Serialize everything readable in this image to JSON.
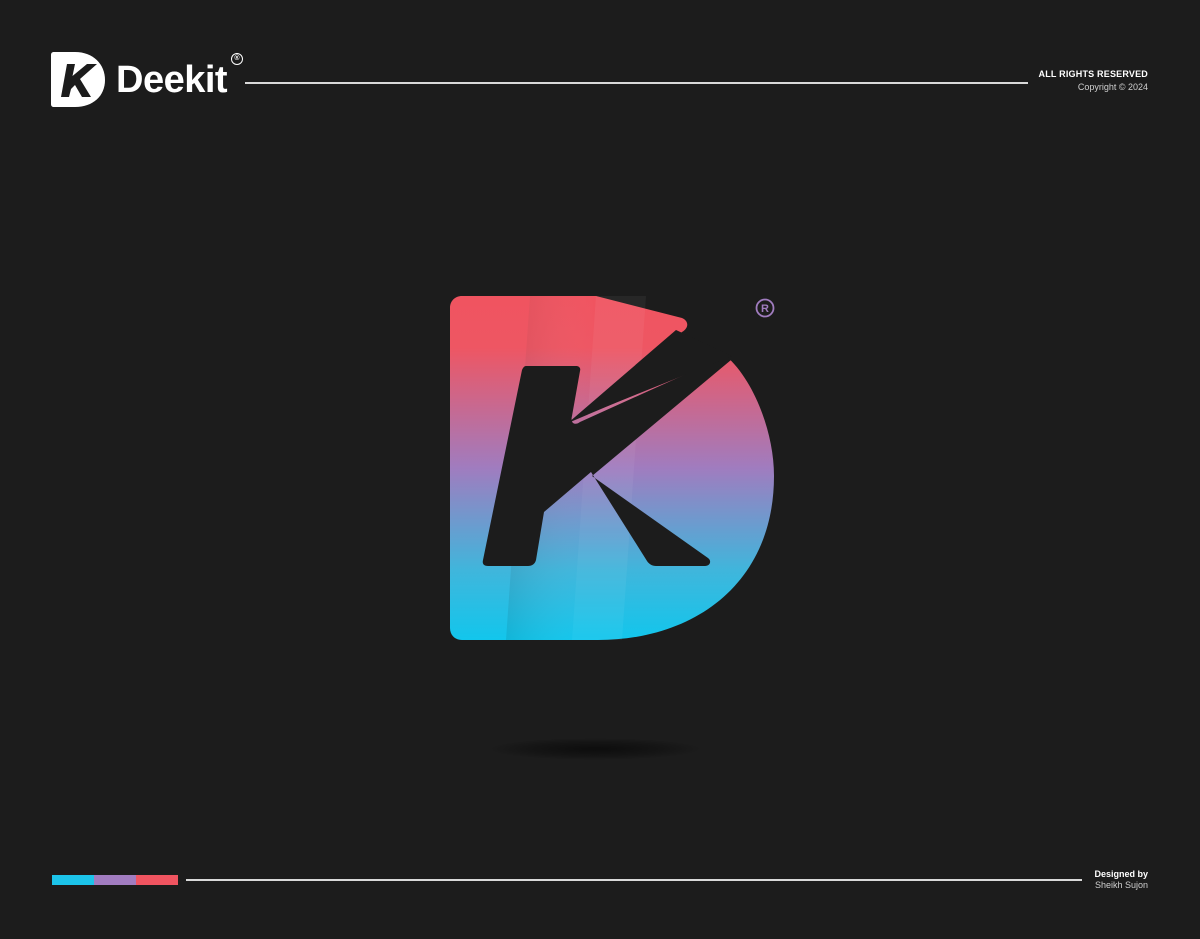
{
  "brand": {
    "name": "Deekit",
    "reg_symbol": "®"
  },
  "header": {
    "rights": "ALL RIGHTS RESERVED",
    "copyright": "Copyright © 2024"
  },
  "footer": {
    "designed_by_label": "Designed by",
    "designer_name": "Sheikh Sujon"
  },
  "colors": {
    "background": "#1c1c1c",
    "gradient_top": "#f05460",
    "gradient_mid": "#9b7cc2",
    "gradient_bottom": "#14c4ea",
    "palette": [
      "#1cc4ea",
      "#a17cc0",
      "#f05460"
    ]
  },
  "icons": {
    "header_logo": "dk-monogram-logo-icon",
    "main_logo": "dk-gradient-logo-icon"
  }
}
